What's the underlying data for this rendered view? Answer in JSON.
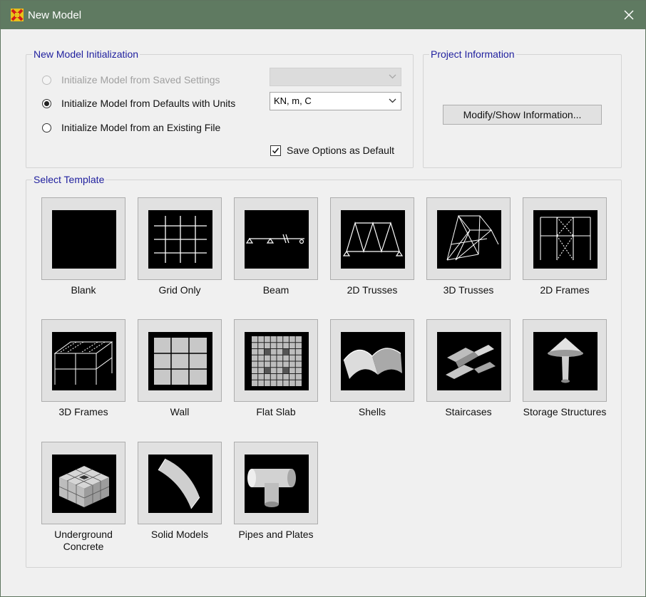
{
  "window": {
    "title": "New Model"
  },
  "init_group": {
    "legend": "New Model Initialization",
    "options": [
      {
        "label": "Initialize Model from Saved Settings",
        "selected": false,
        "enabled": false
      },
      {
        "label": "Initialize Model from Defaults with Units",
        "selected": true,
        "enabled": true
      },
      {
        "label": "Initialize Model from an Existing File",
        "selected": false,
        "enabled": true
      }
    ],
    "saved_settings_value": "",
    "units_value": "KN, m, C",
    "save_default": {
      "label": "Save Options as Default",
      "checked": true
    }
  },
  "project_group": {
    "legend": "Project Information",
    "button_label": "Modify/Show Information..."
  },
  "template_group": {
    "legend": "Select Template",
    "templates": [
      {
        "label": "Blank",
        "icon": "blank-template-icon"
      },
      {
        "label": "Grid Only",
        "icon": "grid-only-icon"
      },
      {
        "label": "Beam",
        "icon": "beam-icon"
      },
      {
        "label": "2D Trusses",
        "icon": "2d-trusses-icon"
      },
      {
        "label": "3D Trusses",
        "icon": "3d-trusses-icon"
      },
      {
        "label": "2D Frames",
        "icon": "2d-frames-icon"
      },
      {
        "label": "3D Frames",
        "icon": "3d-frames-icon"
      },
      {
        "label": "Wall",
        "icon": "wall-icon"
      },
      {
        "label": "Flat Slab",
        "icon": "flat-slab-icon"
      },
      {
        "label": "Shells",
        "icon": "shells-icon"
      },
      {
        "label": "Staircases",
        "icon": "staircases-icon"
      },
      {
        "label": "Storage Structures",
        "icon": "storage-structures-icon"
      },
      {
        "label": "Underground Concrete",
        "icon": "underground-concrete-icon"
      },
      {
        "label": "Solid Models",
        "icon": "solid-models-icon"
      },
      {
        "label": "Pipes and Plates",
        "icon": "pipes-and-plates-icon"
      }
    ]
  },
  "colors": {
    "titlebar": "#5f7a61",
    "legend_text": "#1f1f9e",
    "tile_background": "#000000"
  }
}
